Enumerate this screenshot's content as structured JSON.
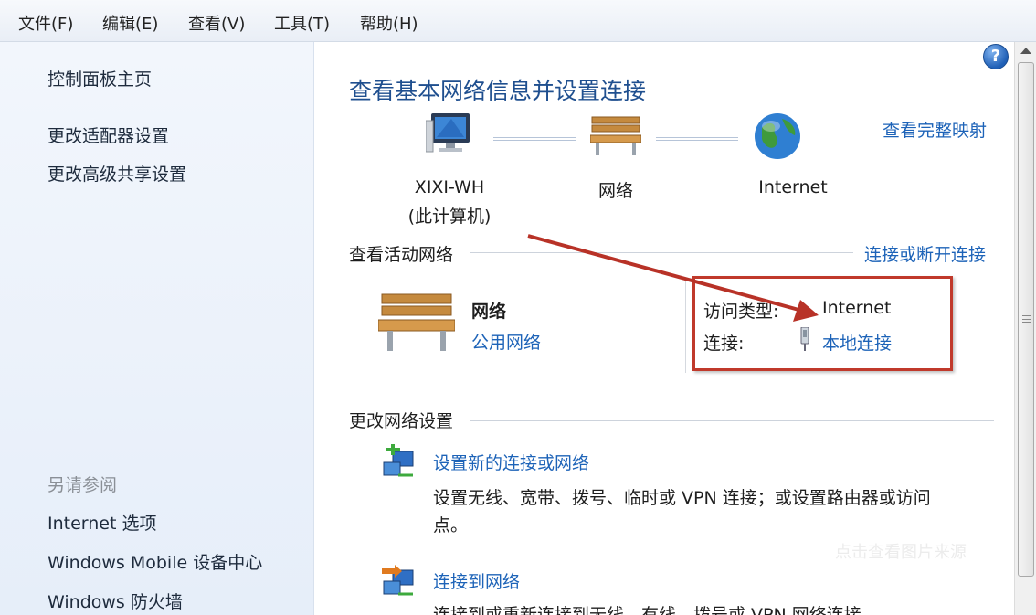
{
  "menu": [
    "文件(F)",
    "编辑(E)",
    "查看(V)",
    "工具(T)",
    "帮助(H)"
  ],
  "sidebar": {
    "home": "控制面板主页",
    "adapter": "更改适配器设置",
    "sharing": "更改高级共享设置",
    "see_also_title": "另请参阅",
    "see_also": [
      "Internet 选项",
      "Windows Mobile 设备中心",
      "Windows 防火墙"
    ]
  },
  "main": {
    "title": "查看基本网络信息并设置连接",
    "full_map": "查看完整映射",
    "computer_name": "XIXI-WH",
    "computer_sub": "(此计算机)",
    "network_node": "网络",
    "internet_node": "Internet",
    "active_title": "查看活动网络",
    "connect_disconnect": "连接或断开连接",
    "active_network": {
      "name": "网络",
      "type": "公用网络",
      "access_label": "访问类型:",
      "access_value": "Internet",
      "conn_label": "连接:",
      "conn_value": "本地连接"
    },
    "change_title": "更改网络设置",
    "tasks": [
      {
        "title": "设置新的连接或网络",
        "desc1": "设置无线、宽带、拨号、临时或 VPN 连接；或设置路由器或访问",
        "desc2": "点。"
      },
      {
        "title": "连接到网络",
        "desc1": "连接到或重新连接到无线、有线、拨号或 VPN 网络连接。"
      }
    ]
  },
  "watermark": "点击查看图片来源",
  "colors": {
    "link": "#1d63b8",
    "title": "#1f4f8f",
    "annotation": "#c0392b"
  },
  "icons": [
    "help-icon",
    "computer-icon",
    "bench-icon",
    "globe-icon",
    "plug-icon",
    "arrow-annotation"
  ]
}
